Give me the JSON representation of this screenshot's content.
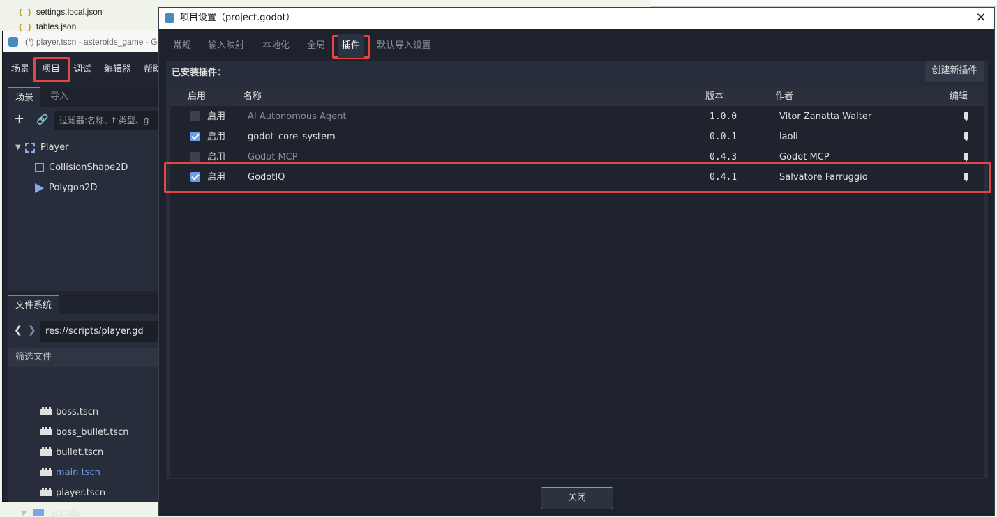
{
  "explorer": {
    "files": [
      "settings.local.json",
      "tables.json"
    ]
  },
  "editor": {
    "window_title": "(*) player.tscn - asteroids_game - Go",
    "menu": [
      "场景",
      "项目",
      "调试",
      "编辑器",
      "帮助"
    ],
    "scene_dock": {
      "tabs": [
        "场景",
        "导入"
      ],
      "filter_placeholder": "过滤器:名称、t:类型、g",
      "tree": [
        "Player",
        "CollisionShape2D",
        "Polygon2D"
      ]
    },
    "filesystem_dock": {
      "tab": "文件系统",
      "path": "res://scripts/player.gd",
      "filter_label": "筛选文件",
      "files": [
        "boss.tscn",
        "boss_bullet.tscn",
        "bullet.tscn",
        "main.tscn",
        "player.tscn"
      ],
      "folder": "scripts"
    }
  },
  "dialog": {
    "title": "项目设置（project.godot）",
    "close_glyph": "✕",
    "tabs": [
      "常规",
      "输入映射",
      "本地化",
      "全局",
      "插件",
      "默认导入设置"
    ],
    "active_tab": "插件",
    "installed_label": "已安装插件：",
    "create_button": "创建新插件",
    "columns": {
      "enabled": "启用",
      "name": "名称",
      "version": "版本",
      "author": "作者",
      "edit": "编辑"
    },
    "plugins": [
      {
        "enabled": false,
        "enable_label": "启用",
        "name": "AI Autonomous Agent",
        "version": "1.0.0",
        "author": "Vitor Zanatta Walter"
      },
      {
        "enabled": true,
        "enable_label": "启用",
        "name": "godot_core_system",
        "version": "0.0.1",
        "author": "laoli"
      },
      {
        "enabled": false,
        "enable_label": "启用",
        "name": "Godot MCP",
        "version": "0.4.3",
        "author": "Godot MCP"
      },
      {
        "enabled": true,
        "enable_label": "启用",
        "name": "GodotIQ",
        "version": "0.4.1",
        "author": "Salvatore Farruggio"
      }
    ],
    "close_button": "关闭"
  },
  "colors": {
    "accent": "#6ca0e8",
    "highlight": "#e64545",
    "panel": "#272d3a"
  }
}
